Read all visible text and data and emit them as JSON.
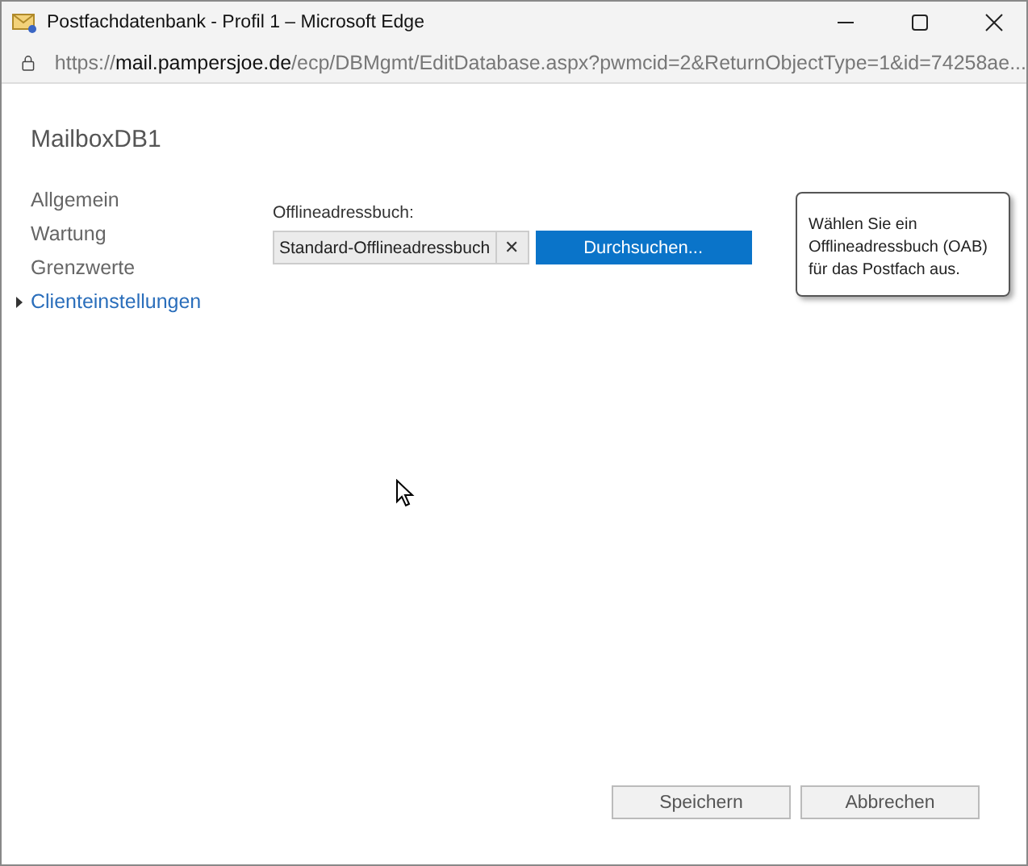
{
  "window": {
    "title": "Postfachdatenbank - Profil 1 – Microsoft Edge"
  },
  "address_bar": {
    "scheme": "https://",
    "host": "mail.pampersjoe.de",
    "path": "/ecp/DBMgmt/EditDatabase.aspx?pwmcid=2&ReturnObjectType=1&id=74258ae..."
  },
  "page_title": "MailboxDB1",
  "nav": [
    {
      "label": "Allgemein",
      "selected": false
    },
    {
      "label": "Wartung",
      "selected": false
    },
    {
      "label": "Grenzwerte",
      "selected": false
    },
    {
      "label": "Clienteinstellungen",
      "selected": true
    }
  ],
  "field": {
    "label": "Offlineadressbuch:",
    "value": "Standard-Offlineadressbuch",
    "clear": "✕",
    "browse": "Durchsuchen..."
  },
  "tooltip": "Wählen Sie ein Offlineadressbuch (OAB) für das Postfach aus.",
  "buttons": [
    "Speichern",
    "Abbrechen"
  ]
}
